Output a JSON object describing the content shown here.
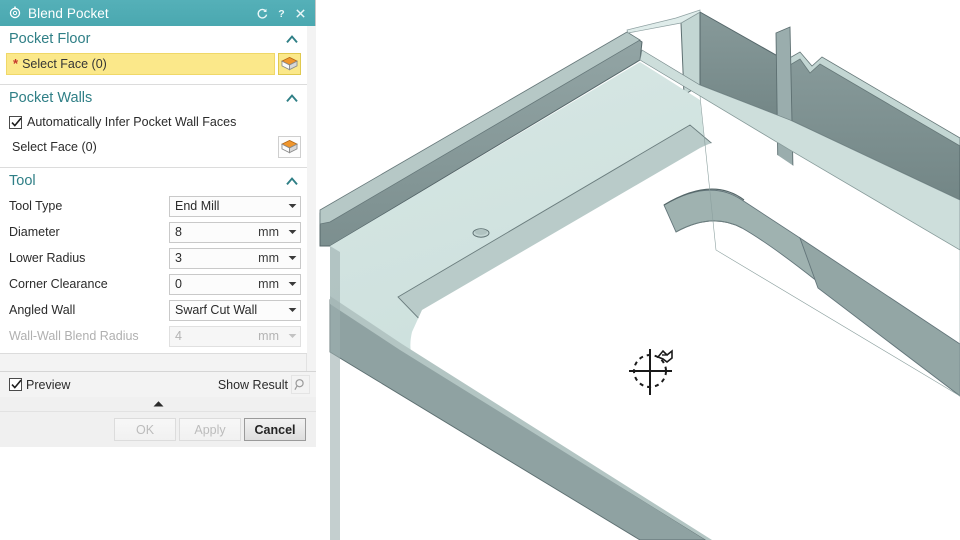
{
  "titlebar": {
    "title": "Blend Pocket",
    "gear_icon": "gear-icon",
    "reset_icon": "reset-icon",
    "help_icon": "help-icon",
    "close_icon": "close-icon",
    "accent_color": "#4fabb3"
  },
  "groups": [
    {
      "id": "pocket-floor",
      "title": "Pocket Floor",
      "collapse_icon": "chevron-up-icon",
      "select_face": {
        "label": "Select Face (0)",
        "required_marker": "*",
        "active": true,
        "face_icon": "select-face-icon",
        "highlight_color": "#fbe88a"
      }
    },
    {
      "id": "pocket-walls",
      "title": "Pocket Walls",
      "collapse_icon": "chevron-up-icon",
      "checkbox": {
        "label": "Automatically Infer Pocket Wall Faces",
        "checked": true
      },
      "select_face": {
        "label": "Select Face (0)",
        "required_marker": "",
        "active": false,
        "face_icon": "select-face-icon"
      }
    },
    {
      "id": "tool",
      "title": "Tool",
      "collapse_icon": "chevron-up-icon"
    }
  ],
  "tool_fields": [
    {
      "label": "Tool Type",
      "value": "End Mill",
      "unit": "",
      "type": "select",
      "disabled": false
    },
    {
      "label": "Diameter",
      "value": "8",
      "unit": "mm",
      "type": "number",
      "disabled": false
    },
    {
      "label": "Lower Radius",
      "value": "3",
      "unit": "mm",
      "type": "number",
      "disabled": false
    },
    {
      "label": "Corner Clearance",
      "value": "0",
      "unit": "mm",
      "type": "number",
      "disabled": false
    },
    {
      "label": "Angled Wall",
      "value": "Swarf Cut Wall",
      "unit": "",
      "type": "select",
      "disabled": false
    },
    {
      "label": "Wall-Wall Blend Radius",
      "value": "4",
      "unit": "mm",
      "type": "number",
      "disabled": true
    }
  ],
  "preview": {
    "checkbox_label": "Preview",
    "checked": true,
    "show_result_label": "Show Result",
    "magnifier_icon": "magnifier-icon",
    "collapse_icon": "triangle-up-icon"
  },
  "buttons": [
    {
      "label": "OK",
      "state": "disabled"
    },
    {
      "label": "Apply",
      "state": "disabled"
    },
    {
      "label": "Cancel",
      "state": "primary"
    }
  ],
  "viewport": {
    "background": "#ffffff",
    "part_top_color": "#cfe1de",
    "part_top_light_color": "#d9e8e5",
    "part_wall_color": "#8c9e9e",
    "part_wall_dark_color": "#7e9191",
    "edge_color": "#5a6a6a",
    "cursor_icon": "crosshair-select-cursor"
  }
}
